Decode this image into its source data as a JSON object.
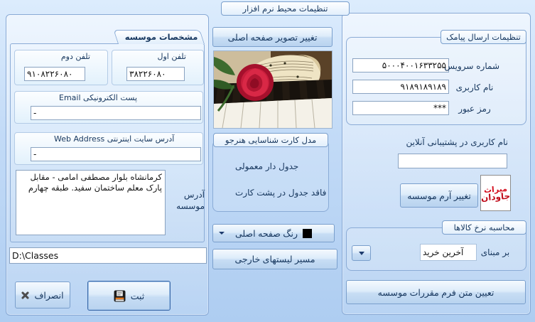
{
  "title": "تنظیمات محیط نرم افزار",
  "left": {
    "tab": "مشخصات موسسه",
    "phone2": {
      "label": "تلفن دوم",
      "value": "۹۱۰۸۲۲۶۰۸۰"
    },
    "phone1": {
      "label": "تلفن اول",
      "value": "۳۸۲۲۶۰۸۰"
    },
    "email": {
      "label": "پست الکترونیکی Email",
      "value": "-"
    },
    "web": {
      "label": "آدرس سایت اینترنتی Web Address",
      "value": "-"
    },
    "address": {
      "label": "آدرس موسسه",
      "value": "کرمانشاه بلوار مصطفی امامی - مقابل پارک معلم ساختمان سفید. طبقه چهارم"
    },
    "path_value": "D:\\Classes",
    "cancel": "انصراف",
    "save": "ثبت"
  },
  "middle": {
    "change_image": "تغییر تصویر صفحه اصلی",
    "card_group": {
      "label": "مدل کارت شناسایی  هنرجو",
      "options": [
        {
          "label": "جدول دار معمولی",
          "selected": true
        },
        {
          "label": "فاقد جدول در پشت کارت",
          "selected": false
        }
      ]
    },
    "main_color": "رنگ صفحه اصلی",
    "color_swatch": "#000000",
    "external_lists": "مسیر لیستهای خارجی"
  },
  "right": {
    "sms": {
      "label": "تنظیمات ارسال پیامک",
      "service": {
        "label": "شماره سرویس",
        "value": "۵۰۰۰۴۰۰۱۶۳۳۲۵۵"
      },
      "user": {
        "label": "نام کاربری",
        "value": "۹۱۸۹۱۸۹۱۸۹"
      },
      "pass": {
        "label": "رمز عبور",
        "value": "***"
      }
    },
    "support_label": "نام کاربری در پشتیبانی آنلاین",
    "support_value": "",
    "change_logo": "تغییر آرم موسسه",
    "logo": {
      "line1": "میراث",
      "line2": "جاودان"
    },
    "price": {
      "label": "محاسبه نرخ کالاها",
      "based_on": "بر مبنای",
      "selected": "آخرین خرید"
    },
    "regulations": "تعیین متن فرم مقررات موسسه"
  }
}
